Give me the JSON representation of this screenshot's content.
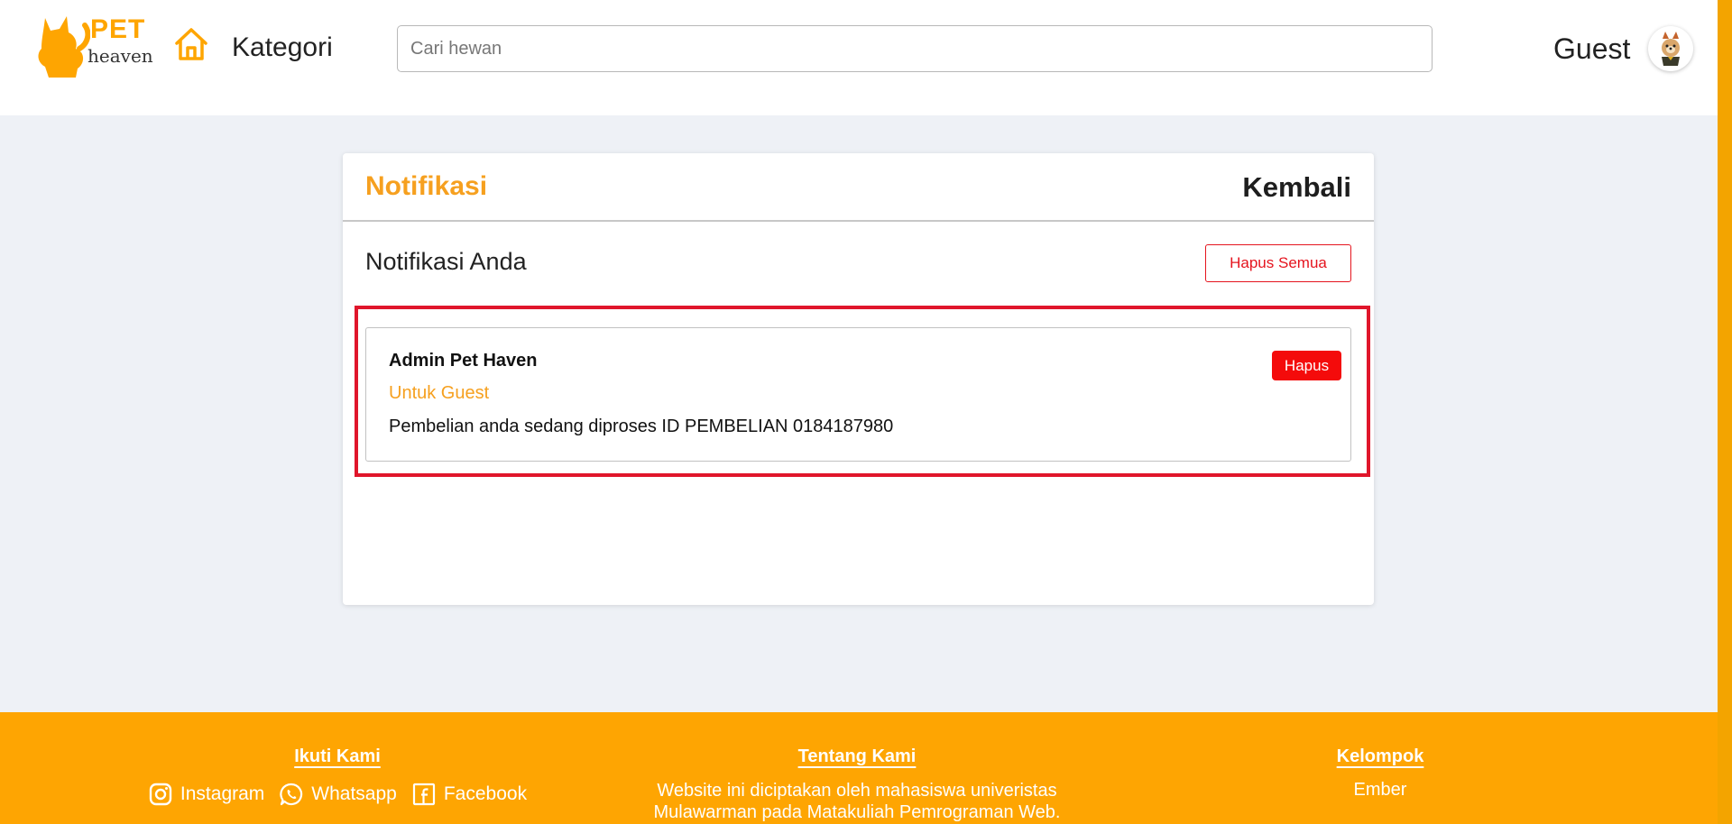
{
  "header": {
    "logo_top": "PET",
    "logo_bottom": "heaven",
    "nav_label": "Kategori",
    "search_placeholder": "Cari hewan",
    "user_name": "Guest"
  },
  "card": {
    "title": "Notifikasi",
    "back_label": "Kembali",
    "section_title": "Notifikasi Anda",
    "delete_all_label": "Hapus Semua",
    "notification": {
      "sender": "Admin Pet Haven",
      "recipient": "Untuk Guest",
      "message": "Pembelian anda sedang diproses ID PEMBELIAN 0184187980",
      "delete_label": "Hapus"
    }
  },
  "footer": {
    "follow_heading": "Ikuti Kami",
    "socials": [
      {
        "label": "Instagram",
        "icon": "instagram-icon"
      },
      {
        "label": "Whatsapp",
        "icon": "whatsapp-icon"
      },
      {
        "label": "Facebook",
        "icon": "facebook-icon"
      }
    ],
    "about_heading": "Tentang Kami",
    "about_line1": "Website ini diciptakan oleh mahasiswa univeristas",
    "about_line2": "Mulawarman pada Matakuliah Pemrograman Web.",
    "group_heading": "Kelompok",
    "group_name": "Ember"
  },
  "colors": {
    "brand": "#fea502",
    "accent_text": "#f6a01f",
    "danger": "#e5141e",
    "background": "#eef1f6"
  }
}
